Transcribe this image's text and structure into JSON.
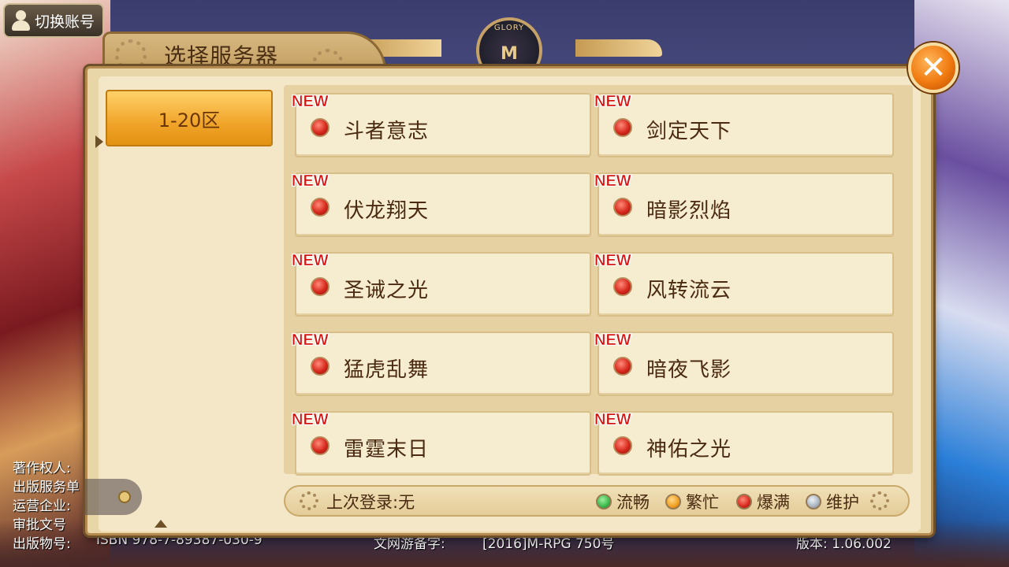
{
  "switch_account": {
    "label": "切换账号",
    "icon": "user-icon"
  },
  "panel": {
    "title": "选择服务器",
    "close_icon": "close-icon"
  },
  "emblem": {
    "text": "GLORY",
    "mark": "M"
  },
  "regions": [
    {
      "label": "1-20区",
      "selected": true
    }
  ],
  "servers": [
    {
      "new_label": "NEW",
      "name": "斗者意志",
      "status": "爆满"
    },
    {
      "new_label": "NEW",
      "name": "剑定天下",
      "status": "爆满"
    },
    {
      "new_label": "NEW",
      "name": "伏龙翔天",
      "status": "爆满"
    },
    {
      "new_label": "NEW",
      "name": "暗影烈焰",
      "status": "爆满"
    },
    {
      "new_label": "NEW",
      "name": "圣诫之光",
      "status": "爆满"
    },
    {
      "new_label": "NEW",
      "name": "风转流云",
      "status": "爆满"
    },
    {
      "new_label": "NEW",
      "name": "猛虎乱舞",
      "status": "爆满"
    },
    {
      "new_label": "NEW",
      "name": "暗夜飞影",
      "status": "爆满"
    },
    {
      "new_label": "NEW",
      "name": "雷霆末日",
      "status": "爆满"
    },
    {
      "new_label": "NEW",
      "name": "神佑之光",
      "status": "爆满"
    }
  ],
  "last_login": "上次登录:无",
  "legend": [
    {
      "label": "流畅",
      "color": "#3bb84a"
    },
    {
      "label": "繁忙",
      "color": "#f0a020"
    },
    {
      "label": "爆满",
      "color": "#d6281c"
    },
    {
      "label": "维护",
      "color": "#a8b4c0"
    }
  ],
  "legal": {
    "copyright": "著作权人:",
    "publisher_service": "出版服务单",
    "operator": "运营企业:",
    "approval": "审批文号",
    "publication": "出版物号:",
    "isbn": "ISBN 978-7-89387-030-9",
    "culture_record": "文网游备字:",
    "culture_record_value": "[2016]M-RPG 750号",
    "version": "版本: 1.06.002"
  }
}
